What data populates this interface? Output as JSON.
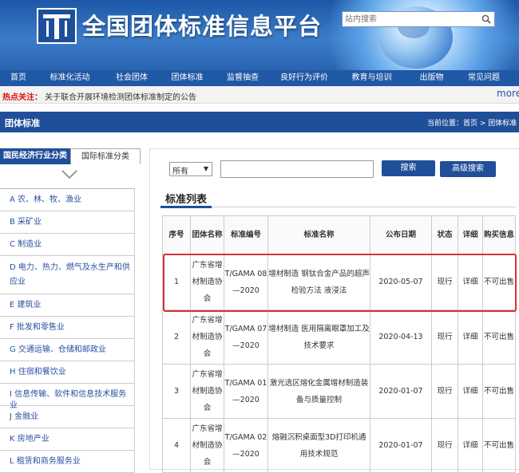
{
  "header": {
    "site_title": "全国团体标准信息平台",
    "search_placeholder": "站内搜索",
    "search_icon": "search-icon",
    "logo_icon": "t-logo-icon"
  },
  "nav": [
    "首页",
    "标准化活动",
    "社会团体",
    "团体标准",
    "监督抽查",
    "良好行为评价",
    "教育与培训",
    "出版物",
    "常见问题"
  ],
  "hot": {
    "label": "热点关注：",
    "text": "关于联合开展环境检测团体标准制定的公告",
    "more": "more"
  },
  "section": {
    "title": "团体标准",
    "breadcrumb": "当前位置：首页 > 团体标准"
  },
  "sidebar": {
    "tabs": [
      "国民经济行业分类",
      "国际标准分类"
    ],
    "items": [
      "A 农、林、牧、渔业",
      "B 采矿业",
      "C 制造业",
      "D 电力、热力、燃气及水生产和供应业",
      "E 建筑业",
      "F 批发和零售业",
      "G 交通运输、仓储和邮政业",
      "H 住宿和餐饮业",
      "I 信息传输、软件和信息技术服务业",
      "J 金融业",
      "K 房地产业",
      "L 租赁和商务服务业"
    ]
  },
  "search": {
    "filter_value": "所有",
    "search_button": "搜索",
    "advanced_button": "高级搜索"
  },
  "list": {
    "title": "标准列表",
    "headers": [
      "序号",
      "团体名称",
      "标准编号",
      "标准名称",
      "公布日期",
      "状态",
      "详细",
      "购买信息"
    ],
    "rows": [
      {
        "no": "1",
        "org": "广东省增材制造协会",
        "code": "T/GAMA 08—2020",
        "name": "增材制造 钢钛合金产品的超声检验方法 液浸法",
        "date": "2020-05-07",
        "status": "现行",
        "detail": "详细",
        "buy": "不可出售"
      },
      {
        "no": "2",
        "org": "广东省增材制造协会",
        "code": "T/GAMA 07—2020",
        "name": "增材制造 医用隔离眼罩加工及技术要求",
        "date": "2020-04-13",
        "status": "现行",
        "detail": "详细",
        "buy": "不可出售"
      },
      {
        "no": "3",
        "org": "广东省增材制造协会",
        "code": "T/GAMA 01—2020",
        "name": "激光选区熔化金属增材制造装备与质量控制",
        "date": "2020-01-07",
        "status": "现行",
        "detail": "详细",
        "buy": "不可出售"
      },
      {
        "no": "4",
        "org": "广东省增材制造协会",
        "code": "T/GAMA 02—2020",
        "name": "熔融沉积桌面型3D打印机通用技术规范",
        "date": "2020-01-07",
        "status": "现行",
        "detail": "详细",
        "buy": "不可出售"
      }
    ]
  },
  "colors": {
    "banner": "#2a64b0",
    "nav": "#1f58a5",
    "primary": "#1f4f99",
    "hot_label": "#dd1111",
    "link": "#8a2b8a",
    "highlight": "#d83232"
  }
}
